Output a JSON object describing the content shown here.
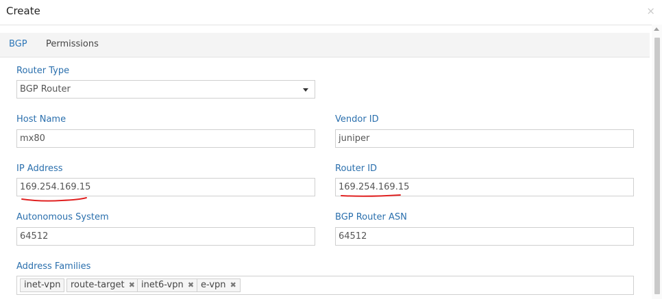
{
  "dialog": {
    "title": "Create",
    "close_icon": "×"
  },
  "tabs": [
    {
      "label": "BGP",
      "active": true
    },
    {
      "label": "Permissions",
      "active": false
    }
  ],
  "form": {
    "router_type": {
      "label": "Router Type",
      "value": "BGP Router"
    },
    "host_name": {
      "label": "Host Name",
      "value": "mx80"
    },
    "vendor_id": {
      "label": "Vendor ID",
      "value": "juniper"
    },
    "ip_address": {
      "label": "IP Address",
      "value": "169.254.169.15"
    },
    "router_id": {
      "label": "Router ID",
      "value": "169.254.169.15"
    },
    "autonomous_system": {
      "label": "Autonomous System",
      "value": "64512"
    },
    "bgp_router_asn": {
      "label": "BGP Router ASN",
      "value": "64512"
    },
    "address_families": {
      "label": "Address Families",
      "tags": [
        "inet-vpn",
        "route-target",
        "inet6-vpn",
        "e-vpn"
      ],
      "remove_icon": "✖"
    }
  },
  "annotation_color": "#e02020",
  "accent_color": "#2c76b8"
}
